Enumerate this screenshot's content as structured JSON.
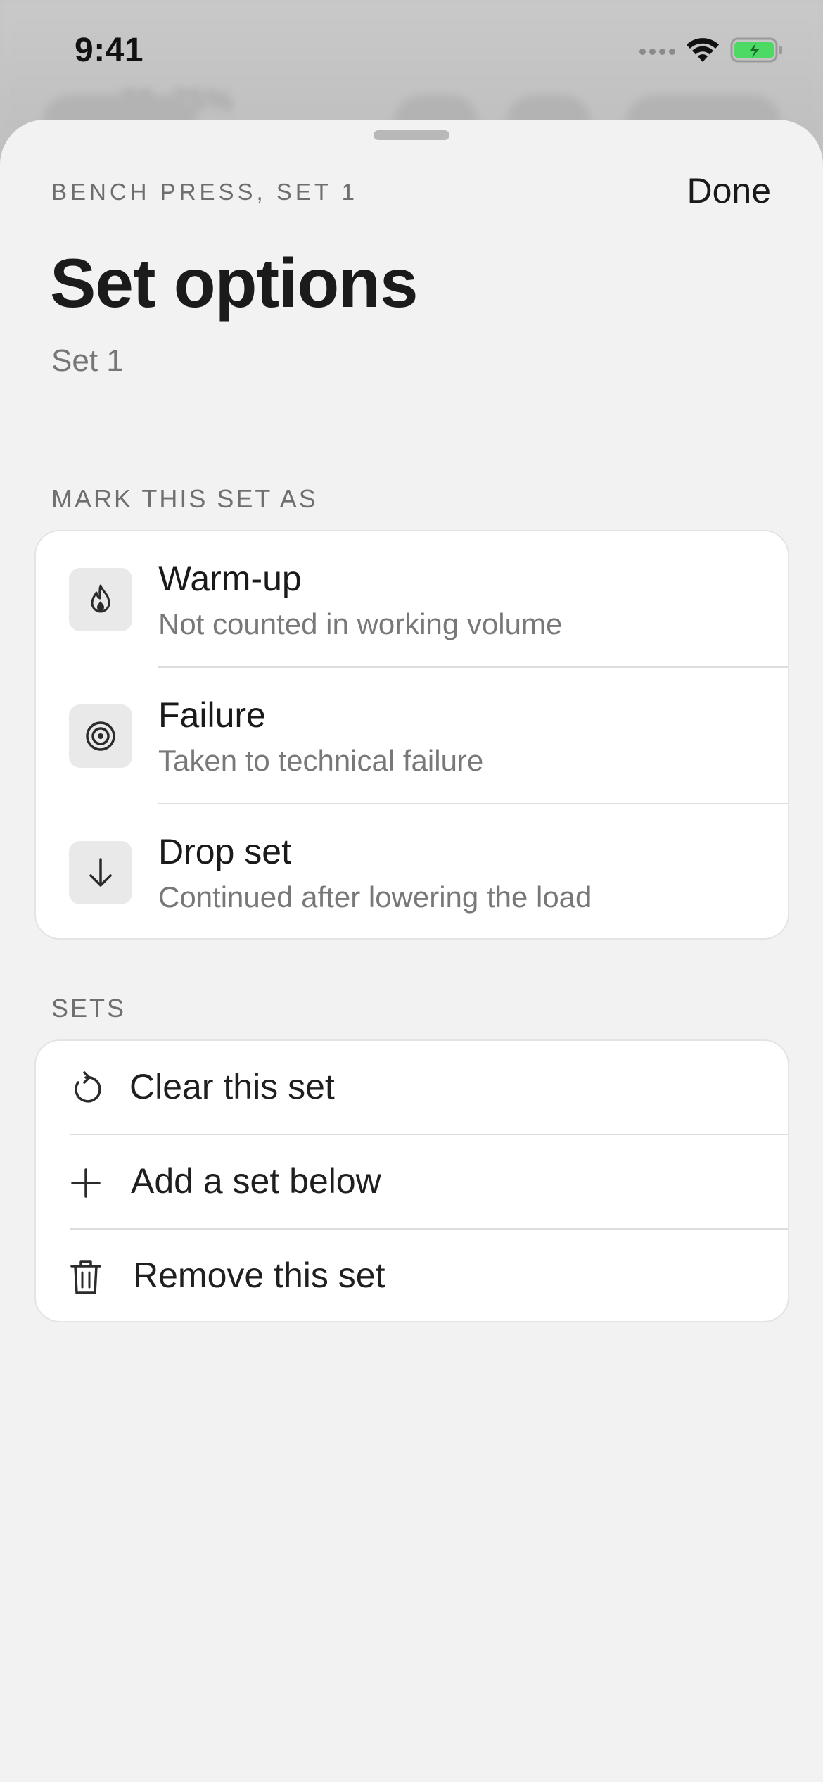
{
  "status_bar": {
    "time": "9:41",
    "icons": [
      "cellular-signal-icon",
      "wifi-icon",
      "battery-charging-icon"
    ],
    "battery_color": "#4cd964"
  },
  "background_app": {
    "ghost_text": "70–75%"
  },
  "sheet": {
    "eyebrow": "BENCH PRESS, SET 1",
    "done_label": "Done",
    "title": "Set options",
    "subtitle": "Set 1"
  },
  "mark_section": {
    "header": "MARK THIS SET AS",
    "items": [
      {
        "icon": "flame-icon",
        "title": "Warm-up",
        "subtitle": "Not counted in working volume"
      },
      {
        "icon": "target-icon",
        "title": "Failure",
        "subtitle": "Taken to technical failure"
      },
      {
        "icon": "arrow-down-icon",
        "title": "Drop set",
        "subtitle": "Continued after lowering the load"
      }
    ]
  },
  "sets_section": {
    "header": "SETS",
    "items": [
      {
        "icon": "reset-icon",
        "label": "Clear this set"
      },
      {
        "icon": "plus-icon",
        "label": "Add a set below"
      },
      {
        "icon": "trash-icon",
        "label": "Remove this set"
      }
    ]
  },
  "colors": {
    "sheet_background": "#f2f2f2",
    "card_background": "#ffffff",
    "primary_text": "#1a1a1a",
    "secondary_text": "#787878",
    "accent_battery": "#4cd964"
  }
}
